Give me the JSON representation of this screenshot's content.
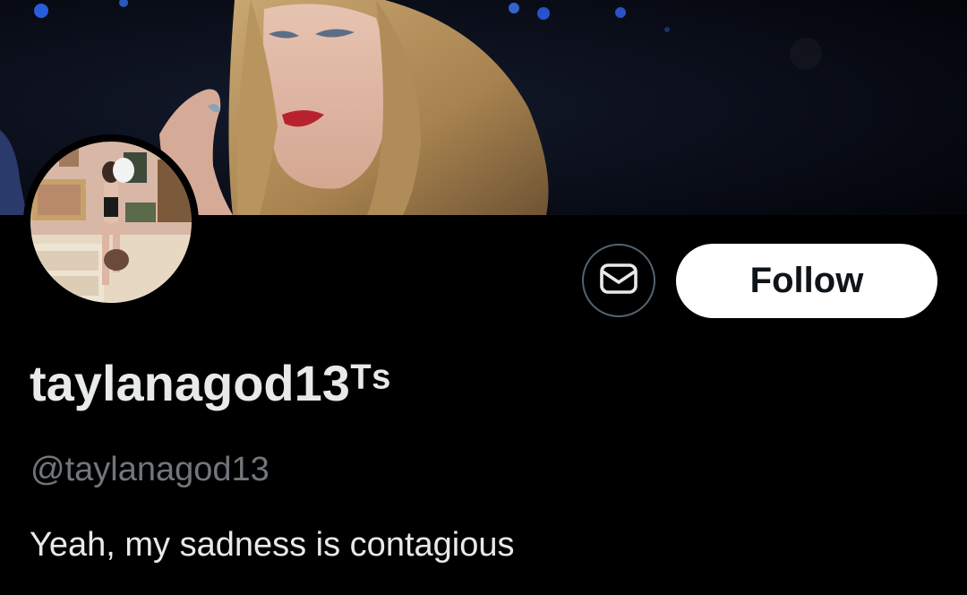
{
  "profile": {
    "display_name": "taylanagod13ᵀˢ",
    "handle": "@taylanagod13",
    "bio": "Yeah, my sadness is contagious"
  },
  "actions": {
    "follow_label": "Follow",
    "message_icon": "envelope-icon"
  },
  "colors": {
    "background": "#000000",
    "primary_text": "#e7e9ea",
    "secondary_text": "#71767b",
    "follow_button_bg": "#ffffff",
    "follow_button_text": "#0f1419",
    "outline": "#536471"
  }
}
